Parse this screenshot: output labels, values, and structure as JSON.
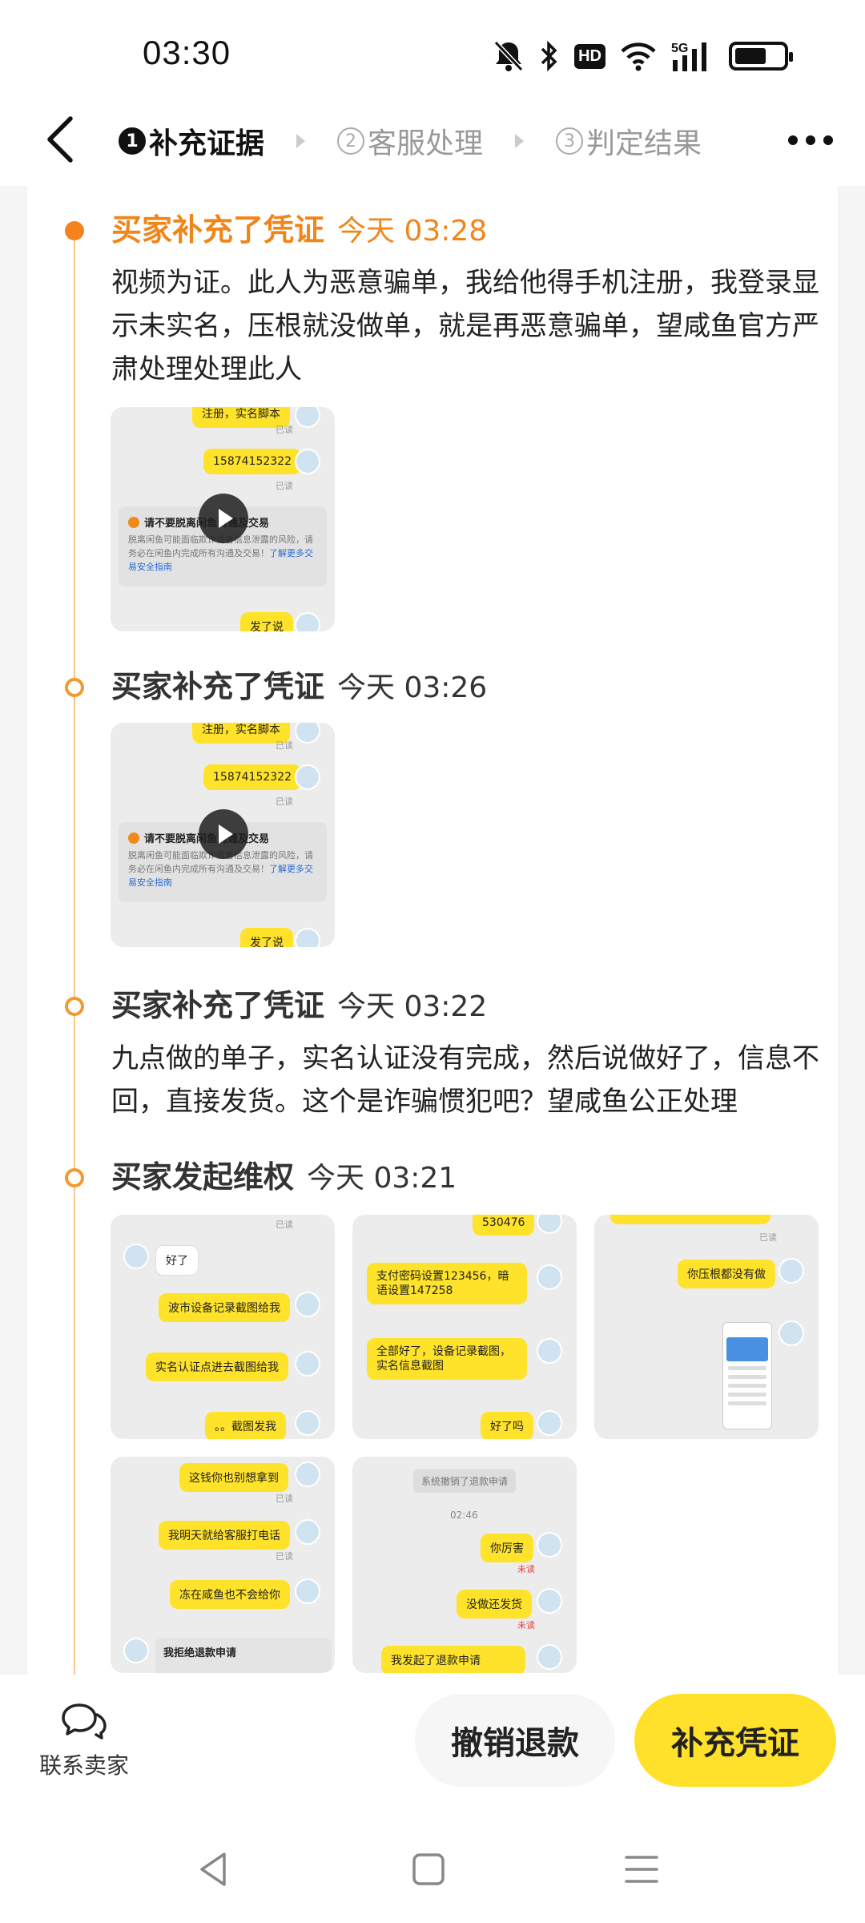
{
  "status_bar": {
    "time": "03:30",
    "icons": [
      "mute-bell-icon",
      "bluetooth-icon",
      "hd-icon",
      "wifi-icon",
      "5g-signal-icon",
      "battery-icon"
    ],
    "hd_label": "HD",
    "network_label": "5G"
  },
  "nav": {
    "steps": [
      {
        "num": "1",
        "label": "补充证据",
        "active": true
      },
      {
        "num": "2",
        "label": "客服处理",
        "active": false
      },
      {
        "num": "3",
        "label": "判定结果",
        "active": false
      }
    ]
  },
  "timeline": [
    {
      "title": "买家补充了凭证",
      "time": "今天 03:28",
      "highlight": true,
      "text": "视频为证。此人为恶意骗单，我给他得手机注册，我登录显示未实名，压根就没做单，就是再恶意骗单，望咸鱼官方严肃处理处理此人",
      "video": {
        "phone": "15874152322",
        "read": "已读",
        "warning_title": "请不要脱离闲鱼沟通及交易",
        "warning_body": "脱离闲鱼可能面临欺诈或者信息泄露的风险，请务必在闲鱼内完成所有沟通及交易！",
        "warning_link": "了解更多交易安全指南",
        "last_msg": "发了说",
        "top_msg": "注册，实名脚本"
      }
    },
    {
      "title": "买家补充了凭证",
      "time": "今天 03:26",
      "highlight": false,
      "video": {
        "phone": "15874152322",
        "read": "已读",
        "warning_title": "请不要脱离闲鱼沟通及交易",
        "warning_body": "脱离闲鱼可能面临欺诈或者信息泄露的风险，请务必在闲鱼内完成所有沟通及交易！",
        "warning_link": "了解更多交易安全指南",
        "last_msg": "发了说",
        "top_msg": "注册，实名脚本"
      }
    },
    {
      "title": "买家补充了凭证",
      "time": "今天 03:22",
      "highlight": false,
      "text": "九点做的单子，实名认证没有完成，然后说做好了，信息不回，直接发货。这个是诈骗惯犯吧？望咸鱼公正处理"
    },
    {
      "title": "买家发起维权",
      "time": "今天 03:21",
      "highlight": false,
      "images": {
        "img1": {
          "m1": "好了",
          "m2": "波市设备记录截图给我",
          "m3": "实名认证点进去截图给我",
          "m4": "。。截图发我",
          "read": "已读"
        },
        "img2": {
          "m0": "530476",
          "m1": "支付密码设置123456，暗语设置147258",
          "m2": "全部好了，设备记录截图，实名信息截图",
          "m3": "好了吗",
          "read": "已读"
        },
        "img3": {
          "m1": "你压根都没有做",
          "read": "已读"
        },
        "img4": {
          "m1": "这钱你也别想拿到",
          "m2": "我明天就给客服打电话",
          "m3": "冻在咸鱼也不会给你",
          "m4": "我拒绝退款申请",
          "read": "已读"
        },
        "img5": {
          "sys": "系统撤销了退款申请",
          "time": "02:46",
          "m1": "你厉害",
          "m2": "没做还发货",
          "m3": "我发起了退款申请",
          "unread": "未读"
        }
      }
    }
  ],
  "bottom": {
    "contact_label": "联系卖家",
    "cancel_label": "撤销退款",
    "supplement_label": "补充凭证"
  },
  "colors": {
    "accent_orange": "#f0861a",
    "brand_yellow": "#ffe12b",
    "timeline_line": "#f5c78e"
  }
}
